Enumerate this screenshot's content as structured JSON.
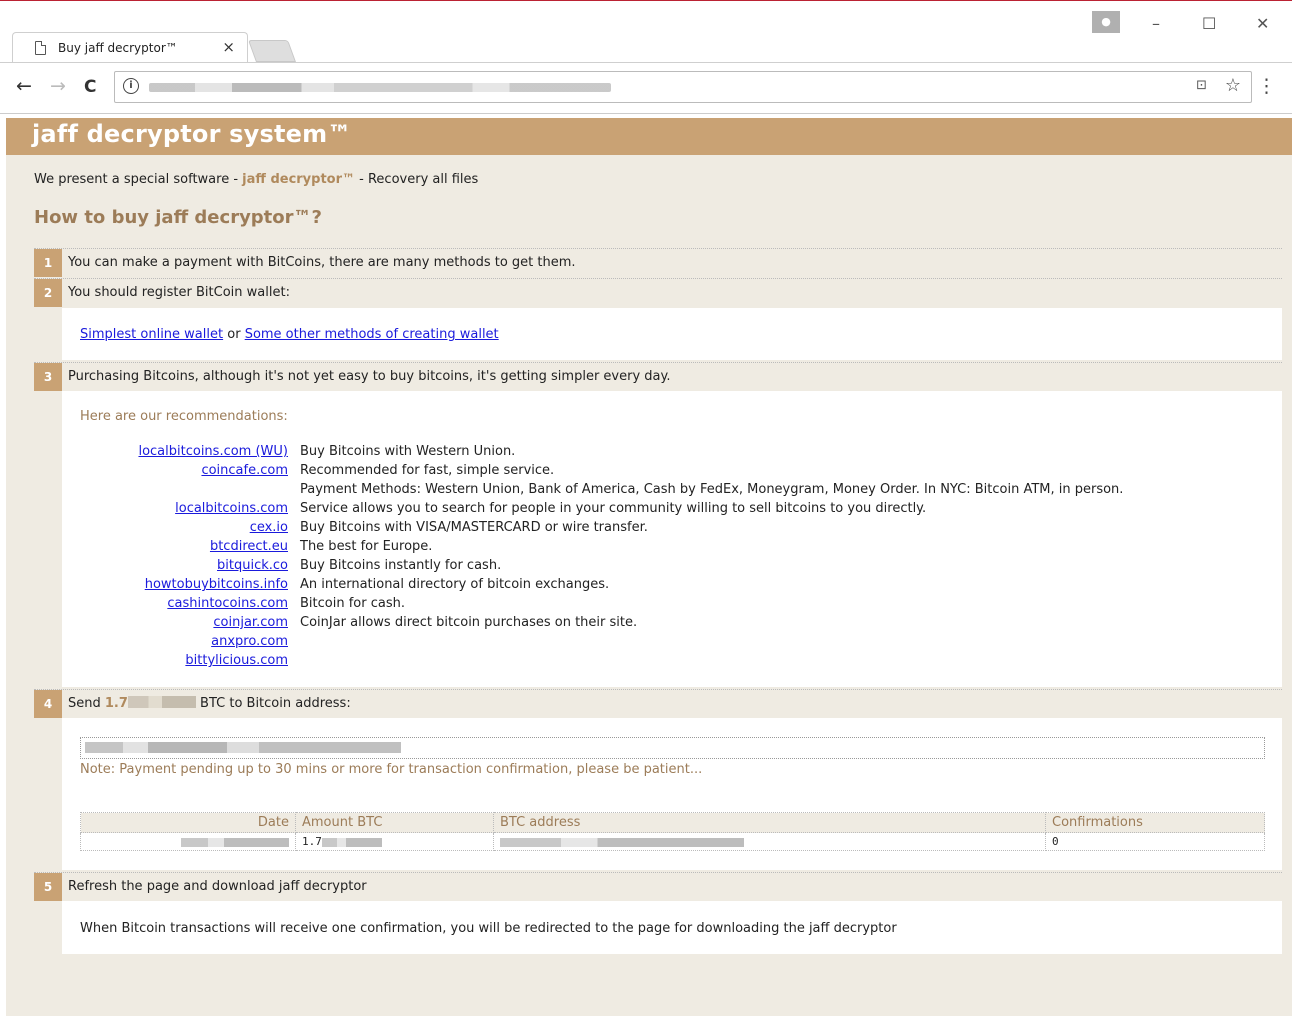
{
  "browser": {
    "tab_title": "Buy jaff decryptor™",
    "tab_close": "×",
    "user_icon": "person-icon",
    "min": "–",
    "max": "☐",
    "close": "✕",
    "back": "←",
    "forward": "→",
    "reload": "C",
    "info": "i",
    "translate": "⊡",
    "star": "☆",
    "menu": "⋮"
  },
  "page": {
    "banner": "jaff decryptor system™",
    "intro_pre": "We present a special software - ",
    "intro_brand": "jaff decryptor™",
    "intro_post": " - Recovery all files",
    "howto": "How to buy jaff decryptor™?",
    "steps": [
      {
        "num": "1",
        "text": "You can make a payment with BitCoins, there are many methods to get them."
      },
      {
        "num": "2",
        "text": "You should register BitCoin wallet:"
      },
      {
        "num": "3",
        "text": "Purchasing Bitcoins, although it's not yet easy to buy bitcoins, it's getting simpler every day."
      },
      {
        "num": "4",
        "text_pre": "Send ",
        "amount": "1.7",
        "text_post": " BTC to Bitcoin address:"
      },
      {
        "num": "5",
        "text": "Refresh the page and download jaff decryptor"
      }
    ],
    "wallet": {
      "link1": "Simplest online wallet",
      "or": " or ",
      "link2": "Some other methods of creating wallet"
    },
    "reco_head": "Here are our recommendations:",
    "reco": [
      {
        "site": "localbitcoins.com (WU)",
        "desc": "Buy Bitcoins with Western Union."
      },
      {
        "site": "coincafe.com",
        "desc": "Recommended for fast, simple service."
      },
      {
        "site": "",
        "desc": "Payment Methods: Western Union, Bank of America, Cash by FedEx, Moneygram, Money Order. In NYC: Bitcoin ATM, in person."
      },
      {
        "site": "localbitcoins.com",
        "desc": "Service allows you to search for people in your community willing to sell bitcoins to you directly."
      },
      {
        "site": "cex.io",
        "desc": "Buy Bitcoins with VISA/MASTERCARD or wire transfer."
      },
      {
        "site": "btcdirect.eu",
        "desc": "The best for Europe."
      },
      {
        "site": "bitquick.co",
        "desc": "Buy Bitcoins instantly for cash."
      },
      {
        "site": "howtobuybitcoins.info",
        "desc": "An international directory of bitcoin exchanges."
      },
      {
        "site": "cashintocoins.com",
        "desc": "Bitcoin for cash."
      },
      {
        "site": "coinjar.com",
        "desc": "CoinJar allows direct bitcoin purchases on their site."
      },
      {
        "site": "anxpro.com",
        "desc": ""
      },
      {
        "site": "bittylicious.com",
        "desc": ""
      }
    ],
    "note": "Note: Payment pending up to 30 mins or more for transaction confirmation, please be patient...",
    "table": {
      "headers": [
        "Date",
        "Amount BTC",
        "BTC address",
        "Confirmations"
      ],
      "row": {
        "amount": "1.7",
        "confirmations": "0"
      }
    },
    "final": "When Bitcoin transactions will receive one confirmation, you will be redirected to the page for downloading the jaff decryptor"
  }
}
